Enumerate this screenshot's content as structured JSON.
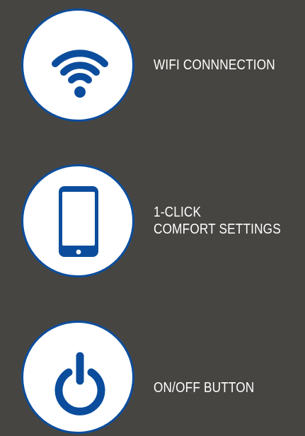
{
  "colors": {
    "background": "#474542",
    "badge_fill": "#ffffff",
    "accent": "#0b4d9c",
    "label_text": "#ffffff"
  },
  "features": [
    {
      "icon": "wifi-icon",
      "label_lines": [
        "WIFI CONNNECTION"
      ]
    },
    {
      "icon": "smartphone-icon",
      "label_lines": [
        "1-CLICK",
        "COMFORT SETTINGS"
      ]
    },
    {
      "icon": "power-icon",
      "label_lines": [
        "ON/OFF BUTTON"
      ]
    }
  ]
}
